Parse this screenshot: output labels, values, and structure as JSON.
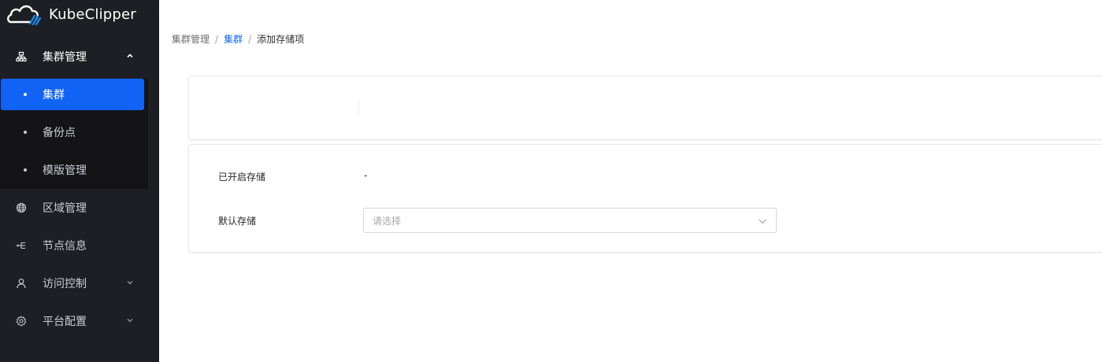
{
  "app": {
    "name": "KubeClipper"
  },
  "sidebar": {
    "groups": [
      {
        "label": "集群管理",
        "icon": "cluster-icon"
      },
      {
        "label": "区域管理",
        "icon": "globe-icon"
      },
      {
        "label": "节点信息",
        "icon": "node-icon"
      },
      {
        "label": "访问控制",
        "icon": "user-icon"
      },
      {
        "label": "平台配置",
        "icon": "gear-icon"
      }
    ],
    "subitems": [
      {
        "label": "集群"
      },
      {
        "label": "备份点"
      },
      {
        "label": "模版管理"
      }
    ]
  },
  "breadcrumb": {
    "root": "集群管理",
    "sep": "/",
    "parent": "集群",
    "current": "添加存储项"
  },
  "form": {
    "enabled_storage_label": "已开启存储",
    "enabled_storage_value": "-",
    "default_storage_label": "默认存储",
    "default_storage_placeholder": "请选择"
  },
  "colors": {
    "sidebar_bg": "#1e1f24",
    "submenu_bg": "#141417",
    "accent": "#1163f5",
    "logo_blue": "#1c8cf2"
  }
}
